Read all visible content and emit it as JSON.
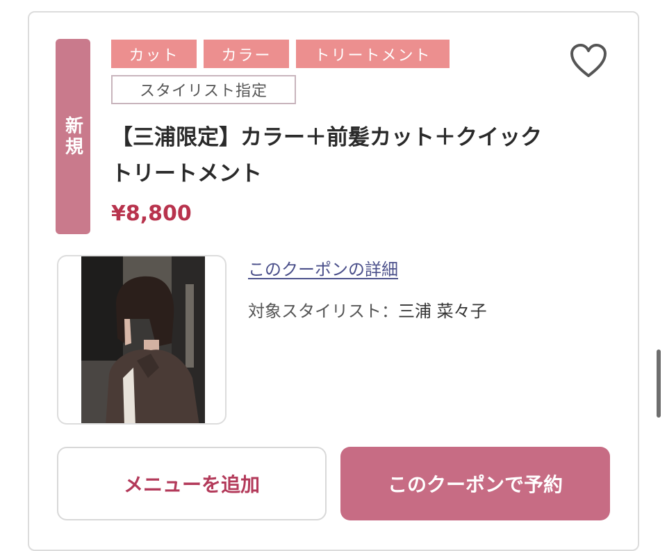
{
  "coupon": {
    "new_badge": "新規",
    "tags": [
      "カット",
      "カラー",
      "トリートメント"
    ],
    "stylist_tag": "スタイリスト指定",
    "title": "【三浦限定】カラー＋前髪カット＋クイックトリートメント",
    "price": "¥8,800",
    "detail_link": "このクーポンの詳細",
    "stylist_label": "対象スタイリスト：",
    "stylist_name": "三浦 菜々子",
    "favorite_icon": "heart-outline-icon"
  },
  "actions": {
    "add_menu": "メニューを追加",
    "reserve": "このクーポンで予約"
  },
  "colors": {
    "badge": "#c97a8c",
    "tag": "#ec8f8f",
    "price": "#b8334d",
    "primary_button": "#c76c84",
    "link": "#4a4f8a"
  }
}
